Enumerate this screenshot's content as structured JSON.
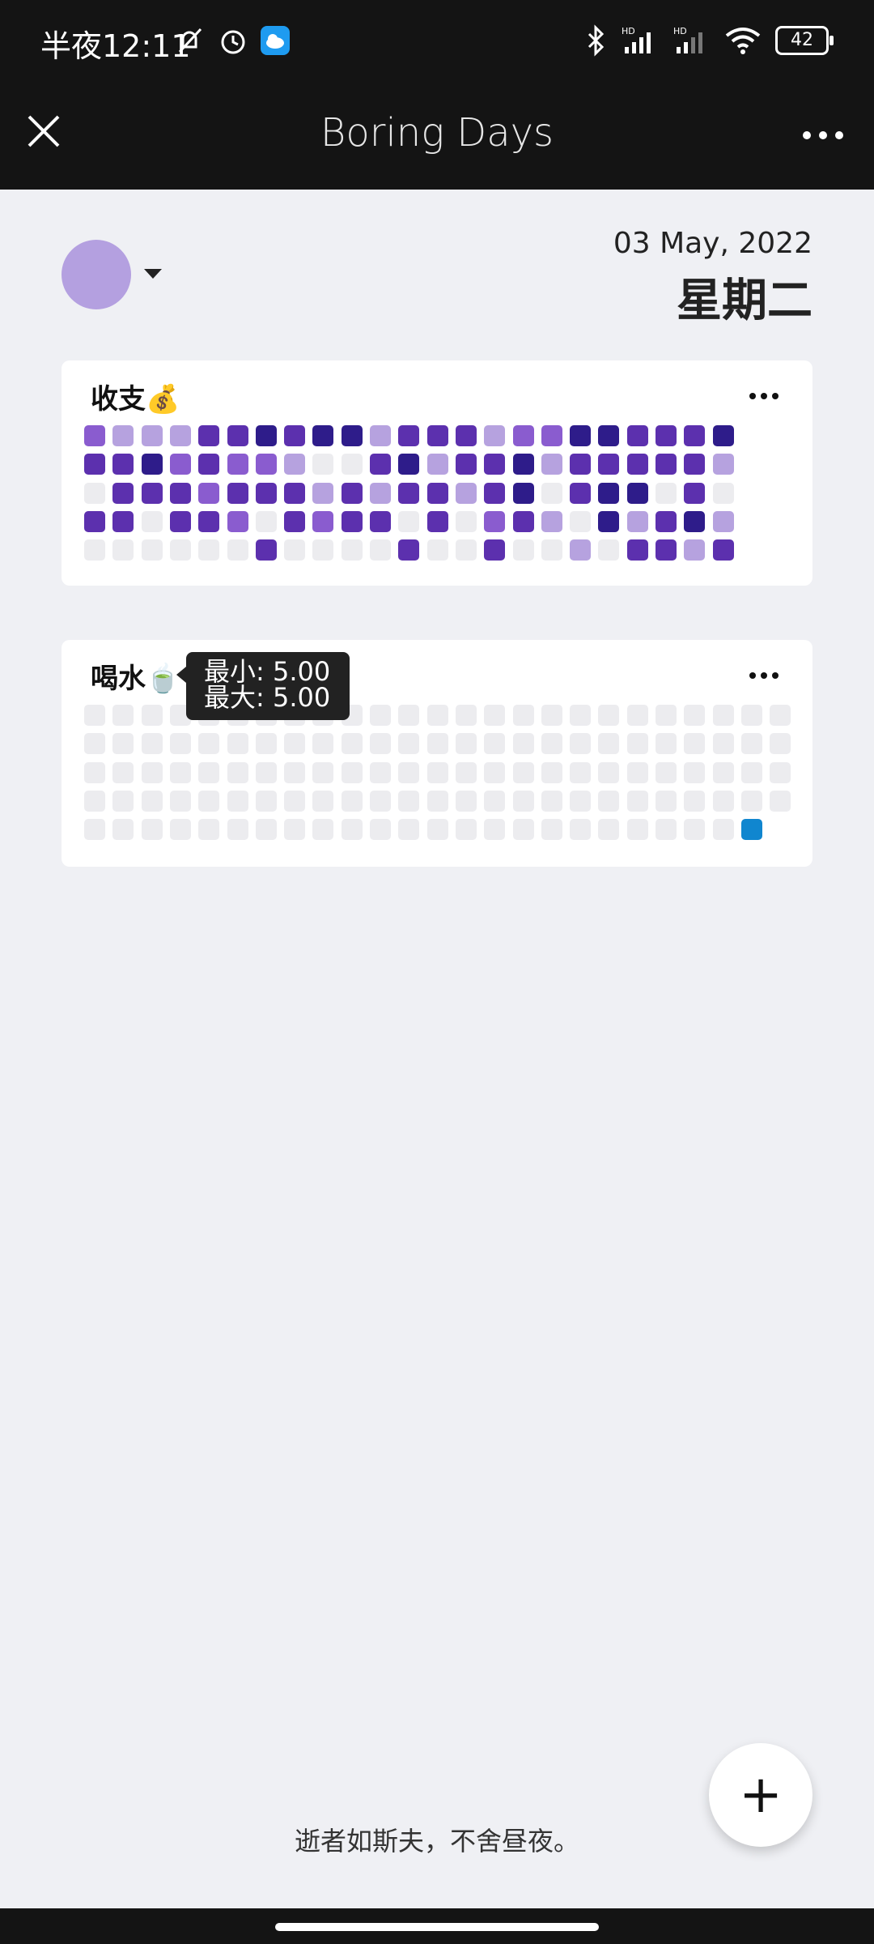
{
  "status_bar": {
    "time": "半夜12:11",
    "battery": "42",
    "icons": [
      "bell-off-icon",
      "alarm-icon",
      "cloud-app-icon",
      "bluetooth-icon",
      "signal-hd-1-icon",
      "signal-hd-2-icon",
      "wifi-icon",
      "battery-icon"
    ]
  },
  "app_bar": {
    "title": "Boring Days",
    "close_icon": "close-icon",
    "more_icon": "more-horizontal-icon"
  },
  "header": {
    "date": "03 May, 2022",
    "weekday": "星期二",
    "avatar_color": "#b4a0e0"
  },
  "cards": [
    {
      "title": "收支💰",
      "grid": [
        [
          2,
          1,
          1,
          1,
          3,
          3,
          4,
          3,
          4,
          4,
          1,
          3,
          3,
          3,
          1,
          2,
          2,
          4,
          4,
          3,
          3,
          3,
          4
        ],
        [
          3,
          3,
          4,
          2,
          3,
          2,
          2,
          1,
          0,
          0,
          3,
          4,
          1,
          3,
          3,
          4,
          1,
          3,
          3,
          3,
          3,
          3,
          1
        ],
        [
          0,
          3,
          3,
          3,
          2,
          3,
          3,
          3,
          1,
          3,
          1,
          3,
          3,
          1,
          3,
          4,
          0,
          3,
          4,
          4,
          0,
          3,
          0
        ],
        [
          3,
          3,
          0,
          3,
          3,
          2,
          0,
          3,
          2,
          3,
          3,
          0,
          3,
          0,
          2,
          3,
          1,
          0,
          4,
          1,
          3,
          4,
          1
        ],
        [
          0,
          0,
          0,
          0,
          0,
          0,
          3,
          0,
          0,
          0,
          0,
          3,
          0,
          0,
          3,
          0,
          0,
          1,
          0,
          3,
          3,
          1,
          3
        ]
      ]
    },
    {
      "title": "喝水🍵",
      "grid_rows": 5,
      "grid_cols": 25,
      "tooltip": {
        "min": "最小: 5.00",
        "max": "最大: 5.00"
      }
    }
  ],
  "palette": {
    "empty": "#ececef",
    "level1": "#b6a2df",
    "level2": "#8a5ccf",
    "level3": "#5c30ae",
    "level4": "#2e1c8a",
    "water_active": "#1086cf"
  },
  "fab": {
    "label": "+"
  },
  "footer": {
    "quote": "逝者如斯夫，不舍昼夜。"
  }
}
